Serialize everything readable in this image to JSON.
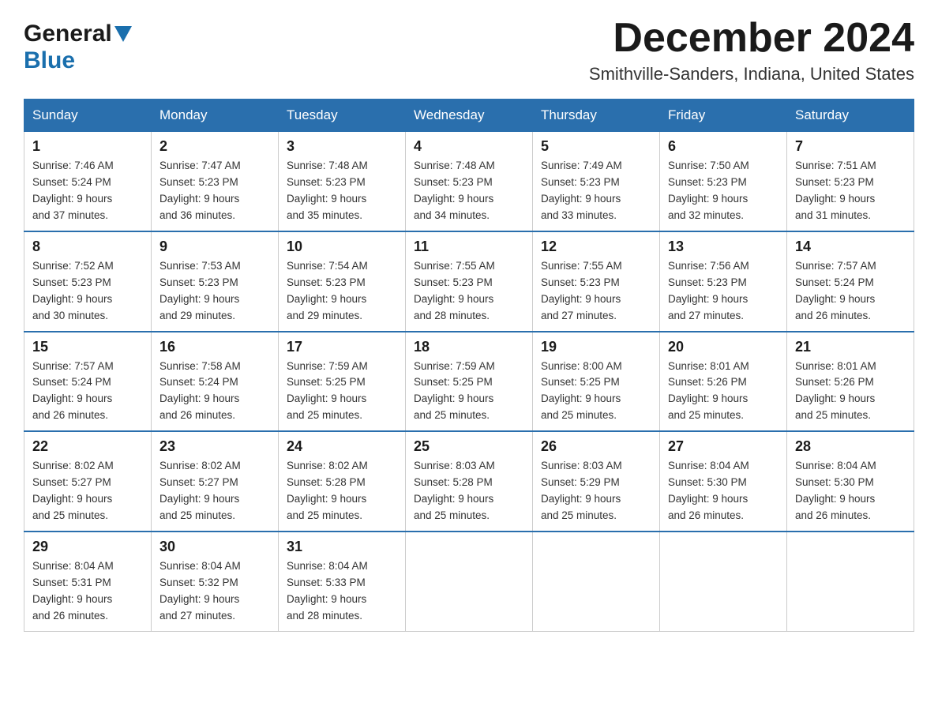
{
  "header": {
    "logo_general": "General",
    "logo_blue": "Blue",
    "month_title": "December 2024",
    "location": "Smithville-Sanders, Indiana, United States"
  },
  "calendar": {
    "days_of_week": [
      "Sunday",
      "Monday",
      "Tuesday",
      "Wednesday",
      "Thursday",
      "Friday",
      "Saturday"
    ],
    "weeks": [
      [
        {
          "day": "1",
          "sunrise": "7:46 AM",
          "sunset": "5:24 PM",
          "daylight": "9 hours and 37 minutes."
        },
        {
          "day": "2",
          "sunrise": "7:47 AM",
          "sunset": "5:23 PM",
          "daylight": "9 hours and 36 minutes."
        },
        {
          "day": "3",
          "sunrise": "7:48 AM",
          "sunset": "5:23 PM",
          "daylight": "9 hours and 35 minutes."
        },
        {
          "day": "4",
          "sunrise": "7:48 AM",
          "sunset": "5:23 PM",
          "daylight": "9 hours and 34 minutes."
        },
        {
          "day": "5",
          "sunrise": "7:49 AM",
          "sunset": "5:23 PM",
          "daylight": "9 hours and 33 minutes."
        },
        {
          "day": "6",
          "sunrise": "7:50 AM",
          "sunset": "5:23 PM",
          "daylight": "9 hours and 32 minutes."
        },
        {
          "day": "7",
          "sunrise": "7:51 AM",
          "sunset": "5:23 PM",
          "daylight": "9 hours and 31 minutes."
        }
      ],
      [
        {
          "day": "8",
          "sunrise": "7:52 AM",
          "sunset": "5:23 PM",
          "daylight": "9 hours and 30 minutes."
        },
        {
          "day": "9",
          "sunrise": "7:53 AM",
          "sunset": "5:23 PM",
          "daylight": "9 hours and 29 minutes."
        },
        {
          "day": "10",
          "sunrise": "7:54 AM",
          "sunset": "5:23 PM",
          "daylight": "9 hours and 29 minutes."
        },
        {
          "day": "11",
          "sunrise": "7:55 AM",
          "sunset": "5:23 PM",
          "daylight": "9 hours and 28 minutes."
        },
        {
          "day": "12",
          "sunrise": "7:55 AM",
          "sunset": "5:23 PM",
          "daylight": "9 hours and 27 minutes."
        },
        {
          "day": "13",
          "sunrise": "7:56 AM",
          "sunset": "5:23 PM",
          "daylight": "9 hours and 27 minutes."
        },
        {
          "day": "14",
          "sunrise": "7:57 AM",
          "sunset": "5:24 PM",
          "daylight": "9 hours and 26 minutes."
        }
      ],
      [
        {
          "day": "15",
          "sunrise": "7:57 AM",
          "sunset": "5:24 PM",
          "daylight": "9 hours and 26 minutes."
        },
        {
          "day": "16",
          "sunrise": "7:58 AM",
          "sunset": "5:24 PM",
          "daylight": "9 hours and 26 minutes."
        },
        {
          "day": "17",
          "sunrise": "7:59 AM",
          "sunset": "5:25 PM",
          "daylight": "9 hours and 25 minutes."
        },
        {
          "day": "18",
          "sunrise": "7:59 AM",
          "sunset": "5:25 PM",
          "daylight": "9 hours and 25 minutes."
        },
        {
          "day": "19",
          "sunrise": "8:00 AM",
          "sunset": "5:25 PM",
          "daylight": "9 hours and 25 minutes."
        },
        {
          "day": "20",
          "sunrise": "8:01 AM",
          "sunset": "5:26 PM",
          "daylight": "9 hours and 25 minutes."
        },
        {
          "day": "21",
          "sunrise": "8:01 AM",
          "sunset": "5:26 PM",
          "daylight": "9 hours and 25 minutes."
        }
      ],
      [
        {
          "day": "22",
          "sunrise": "8:02 AM",
          "sunset": "5:27 PM",
          "daylight": "9 hours and 25 minutes."
        },
        {
          "day": "23",
          "sunrise": "8:02 AM",
          "sunset": "5:27 PM",
          "daylight": "9 hours and 25 minutes."
        },
        {
          "day": "24",
          "sunrise": "8:02 AM",
          "sunset": "5:28 PM",
          "daylight": "9 hours and 25 minutes."
        },
        {
          "day": "25",
          "sunrise": "8:03 AM",
          "sunset": "5:28 PM",
          "daylight": "9 hours and 25 minutes."
        },
        {
          "day": "26",
          "sunrise": "8:03 AM",
          "sunset": "5:29 PM",
          "daylight": "9 hours and 25 minutes."
        },
        {
          "day": "27",
          "sunrise": "8:04 AM",
          "sunset": "5:30 PM",
          "daylight": "9 hours and 26 minutes."
        },
        {
          "day": "28",
          "sunrise": "8:04 AM",
          "sunset": "5:30 PM",
          "daylight": "9 hours and 26 minutes."
        }
      ],
      [
        {
          "day": "29",
          "sunrise": "8:04 AM",
          "sunset": "5:31 PM",
          "daylight": "9 hours and 26 minutes."
        },
        {
          "day": "30",
          "sunrise": "8:04 AM",
          "sunset": "5:32 PM",
          "daylight": "9 hours and 27 minutes."
        },
        {
          "day": "31",
          "sunrise": "8:04 AM",
          "sunset": "5:33 PM",
          "daylight": "9 hours and 28 minutes."
        },
        null,
        null,
        null,
        null
      ]
    ]
  }
}
